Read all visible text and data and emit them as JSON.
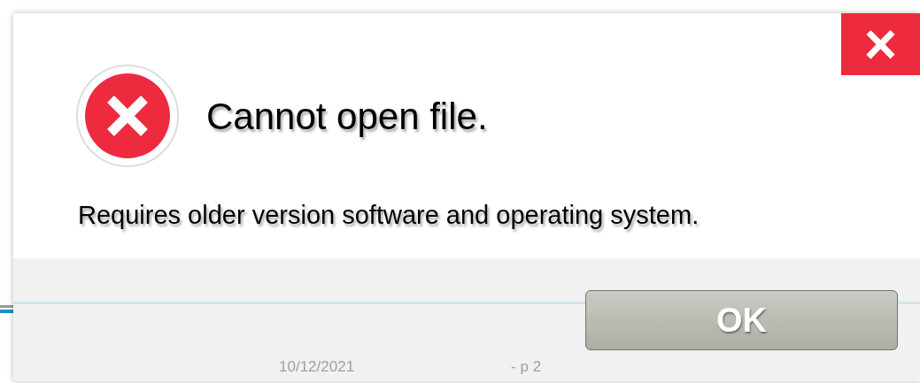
{
  "dialog": {
    "close_button": "×",
    "title": "Cannot open file.",
    "message": "Requires older version software and operating system.",
    "buttons": [
      "OK"
    ]
  },
  "slide_footer": {
    "date": "10/12/2021",
    "page": "- p 2"
  }
}
